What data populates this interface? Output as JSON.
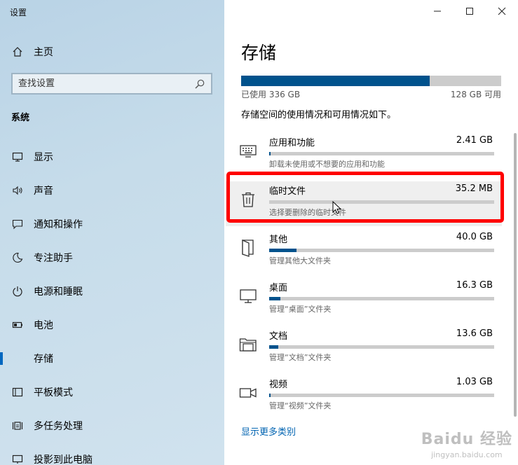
{
  "left": {
    "app_title": "设置",
    "home": {
      "label": "主页",
      "icon": "home-icon"
    },
    "search": {
      "placeholder": "查找设置",
      "icon": "search-icon"
    },
    "section_title": "系统",
    "items": [
      {
        "label": "显示",
        "icon": "display-icon",
        "active": false
      },
      {
        "label": "声音",
        "icon": "speaker-icon",
        "active": false
      },
      {
        "label": "通知和操作",
        "icon": "notification-icon",
        "active": false
      },
      {
        "label": "专注助手",
        "icon": "moon-icon",
        "active": false
      },
      {
        "label": "电源和睡眠",
        "icon": "power-icon",
        "active": false
      },
      {
        "label": "电池",
        "icon": "battery-icon",
        "active": false
      },
      {
        "label": "存储",
        "icon": "storage-icon",
        "active": true
      },
      {
        "label": "平板模式",
        "icon": "tablet-icon",
        "active": false
      },
      {
        "label": "多任务处理",
        "icon": "multitask-icon",
        "active": false
      },
      {
        "label": "投影到此电脑",
        "icon": "project-icon",
        "active": false
      }
    ]
  },
  "right": {
    "title": "存储",
    "used_fraction": 0.724,
    "used_label": "已使用 336 GB",
    "free_label": "128 GB 可用",
    "description": "存储空间的使用情况和可用情况如下。",
    "categories": [
      {
        "name": "应用和功能",
        "size": "2.41 GB",
        "sub": "卸载未使用或不想要的应用和功能",
        "fraction": 0.006,
        "icon": "keyboard-icon"
      },
      {
        "name": "临时文件",
        "size": "35.2 MB",
        "sub": "选择要删除的临时文件",
        "fraction": 0.0,
        "icon": "trash-icon"
      },
      {
        "name": "其他",
        "size": "40.0 GB",
        "sub": "管理其他大文件夹",
        "fraction": 0.12,
        "icon": "door-icon"
      },
      {
        "name": "桌面",
        "size": "16.3 GB",
        "sub": "管理“桌面”文件夹",
        "fraction": 0.05,
        "icon": "monitor-icon"
      },
      {
        "name": "文档",
        "size": "13.6 GB",
        "sub": "管理“文档”文件夹",
        "fraction": 0.04,
        "icon": "folder-icon"
      },
      {
        "name": "视频",
        "size": "1.03 GB",
        "sub": "管理“视频”文件夹",
        "fraction": 0.003,
        "icon": "video-icon"
      }
    ],
    "more_link": "显示更多类别"
  },
  "window": {
    "minimize_icon": "minimize-icon",
    "maximize_icon": "maximize-icon",
    "close_icon": "close-icon"
  },
  "colors": {
    "accent": "#0067c0",
    "bar_fill": "#00528c",
    "bar_bg": "#cccccc",
    "highlight": "#ff0000",
    "link": "#0063b1"
  },
  "watermark": {
    "line1": "Baidu 经验",
    "line2": "jingyan.baidu.com"
  }
}
